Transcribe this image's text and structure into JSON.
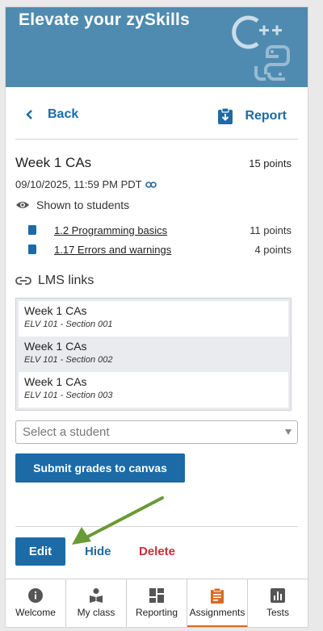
{
  "banner": {
    "title": "Elevate your zySkills"
  },
  "header": {
    "back_label": "Back",
    "report_label": "Report"
  },
  "assignment": {
    "title": "Week 1 CAs",
    "points": "15 points",
    "due": "09/10/2025, 11:59 PM PDT",
    "visibility": "Shown to students",
    "sections": [
      {
        "label": "1.2 Programming basics",
        "points": "11 points"
      },
      {
        "label": "1.17 Errors and warnings",
        "points": "4 points"
      }
    ]
  },
  "lms": {
    "heading": "LMS links",
    "items": [
      {
        "name": "Week 1 CAs",
        "section": "ELV 101 - Section 001"
      },
      {
        "name": "Week 1 CAs",
        "section": "ELV 101 - Section 002"
      },
      {
        "name": "Week 1 CAs",
        "section": "ELV 101 - Section 003"
      }
    ]
  },
  "student_select": {
    "placeholder": "Select a student"
  },
  "actions": {
    "submit": "Submit grades to canvas",
    "edit": "Edit",
    "hide": "Hide",
    "delete": "Delete"
  },
  "tabs": [
    {
      "label": "Welcome",
      "icon": "info-icon"
    },
    {
      "label": "My class",
      "icon": "reader-icon"
    },
    {
      "label": "Reporting",
      "icon": "dashboard-icon"
    },
    {
      "label": "Assignments",
      "icon": "clipboard-icon",
      "active": true
    },
    {
      "label": "Tests",
      "icon": "chart-icon"
    }
  ],
  "colors": {
    "accent": "#1c6ba6",
    "banner": "#4f8bb0",
    "danger": "#cc2d38",
    "active_tab": "#d96a1f",
    "annotation_arrow": "#6a9a35"
  }
}
